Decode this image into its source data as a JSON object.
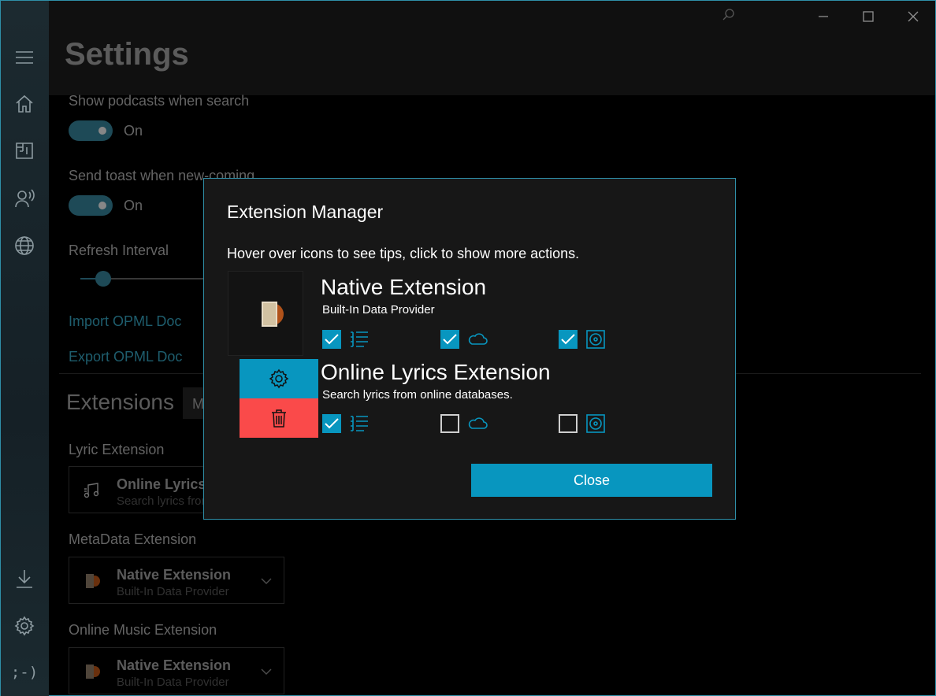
{
  "header": {
    "title": "Settings"
  },
  "window": {
    "search_icon": "search-icon",
    "minimize_icon": "minimize-icon",
    "maximize_icon": "maximize-icon",
    "close_icon": "close-icon"
  },
  "sidebar": {
    "top": [
      "hamburger-icon",
      "home-icon",
      "library-icon",
      "podcast-icon",
      "globe-icon"
    ],
    "bottom": [
      "download-icon",
      "gear-icon",
      "feedback-icon"
    ],
    "feedback_text": ";-)"
  },
  "settings": {
    "podcasts_label": "Show podcasts when search",
    "podcasts_state": "On",
    "toast_label": "Send toast when new-coming",
    "toast_state": "On",
    "refresh_label": "Refresh Interval",
    "import_link": "Import OPML Doc",
    "export_link": "Export OPML Doc",
    "extensions_title": "Extensions",
    "extensions_combo_partial": "M",
    "lyric_label": "Lyric Extension",
    "lyric_combo": {
      "name": "Online Lyrics Extension",
      "desc": "Search lyrics from online databases."
    },
    "meta_label": "MetaData Extension",
    "meta_combo": {
      "name": "Native Extension",
      "desc": "Built-In Data Provider"
    },
    "music_label": "Online Music Extension",
    "music_combo": {
      "name": "Native Extension",
      "desc": "Built-In Data Provider"
    }
  },
  "dialog": {
    "title": "Extension Manager",
    "hint": "Hover over icons to see tips, click to show more actions.",
    "close_label": "Close",
    "extensions": [
      {
        "name": "Native Extension",
        "desc": "Built-In Data Provider",
        "lyric": true,
        "online": true,
        "metadata": true
      },
      {
        "name": "Online Lyrics Extension",
        "desc": "Search lyrics from online databases.",
        "lyric": true,
        "online": false,
        "metadata": false
      }
    ],
    "actions": {
      "settings_icon": "gear-icon",
      "delete_icon": "trash-icon"
    }
  },
  "colors": {
    "accent": "#0896bf",
    "delete": "#fa4a4a",
    "border": "#2f8fa8"
  }
}
